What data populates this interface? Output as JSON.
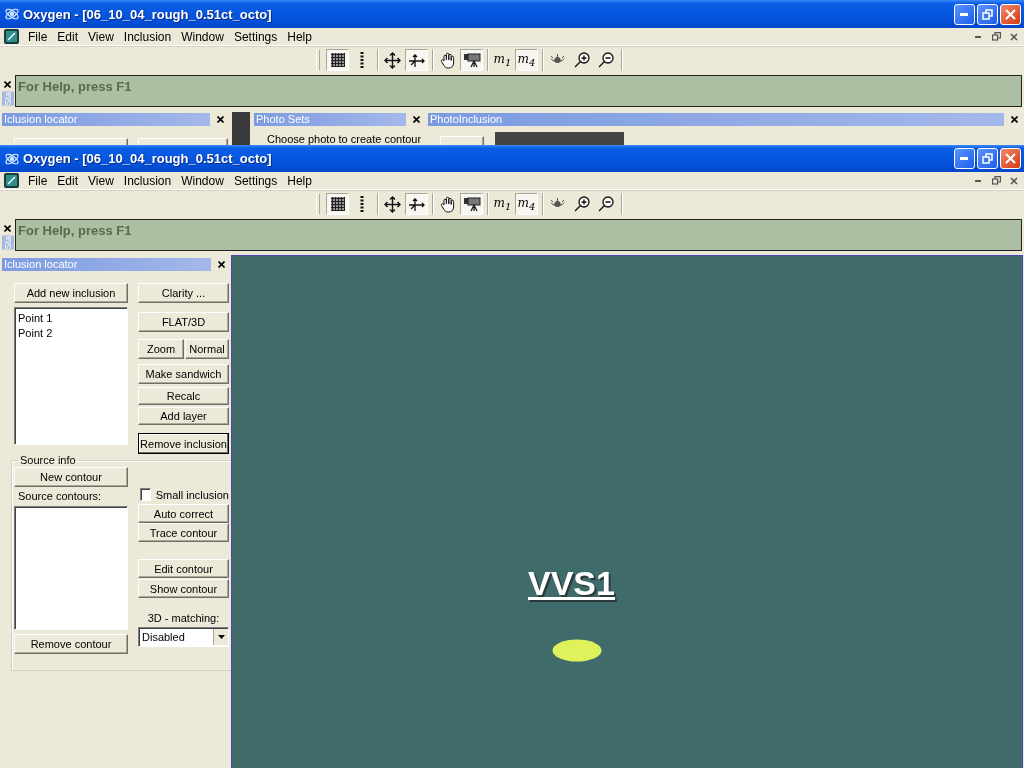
{
  "windows": [
    {
      "kind": "covered",
      "title": "Oxygen - [06_10_04_rough_0.51ct_octo]",
      "menu": [
        "File",
        "Edit",
        "View",
        "Inclusion",
        "Window",
        "Settings",
        "Help"
      ],
      "toolbar": [
        {
          "buttons": [
            {
              "kind": "grid",
              "selected": true
            },
            {
              "kind": "dots",
              "selected": false
            }
          ]
        },
        {
          "buttons": [
            {
              "kind": "move",
              "selected": false
            },
            {
              "kind": "axes",
              "selected": true
            }
          ]
        },
        {
          "buttons": [
            {
              "kind": "hand",
              "selected": false
            },
            {
              "kind": "camera",
              "selected": true
            }
          ]
        },
        {
          "buttons": [
            {
              "kind": "label",
              "label": "m$_{1}$",
              "selected": false
            },
            {
              "kind": "label",
              "label": "m$_{4}$",
              "selected": true
            }
          ]
        },
        {
          "buttons": [
            {
              "kind": "eye",
              "selected": false
            },
            {
              "kind": "zoom_in",
              "selected": false
            },
            {
              "kind": "zoom_out",
              "selected": false
            }
          ]
        }
      ],
      "help_bar": {
        "tab_label": "Sta",
        "text": "For Help, press F1"
      },
      "panels": [
        {
          "kind": "locator",
          "title": "Iclusion locator"
        },
        {
          "kind": "photo_sets",
          "title": "Photo Sets",
          "text": "Choose photo to create contour"
        },
        {
          "kind": "photo_inclusion",
          "title": "PhotoInclusion"
        }
      ]
    },
    {
      "kind": "active",
      "title": "Oxygen - [06_10_04_rough_0.51ct_octo]",
      "menu": [
        "File",
        "Edit",
        "View",
        "Inclusion",
        "Window",
        "Settings",
        "Help"
      ],
      "toolbar": [
        {
          "buttons": [
            {
              "kind": "grid",
              "selected": true
            },
            {
              "kind": "dots",
              "selected": false
            }
          ]
        },
        {
          "buttons": [
            {
              "kind": "move",
              "selected": false
            },
            {
              "kind": "axes",
              "selected": true
            }
          ]
        },
        {
          "buttons": [
            {
              "kind": "hand",
              "selected": false
            },
            {
              "kind": "camera",
              "selected": true
            }
          ]
        },
        {
          "buttons": [
            {
              "kind": "label",
              "label": "m$_{1}$",
              "selected": false
            },
            {
              "kind": "label",
              "label": "m$_{4}$",
              "selected": true
            }
          ]
        },
        {
          "buttons": [
            {
              "kind": "eye",
              "selected": false
            },
            {
              "kind": "zoom_in",
              "selected": false
            },
            {
              "kind": "zoom_out",
              "selected": false
            }
          ]
        }
      ],
      "help_bar": {
        "tab_label": "Sta",
        "text": "For Help, press F1"
      },
      "locator": {
        "title": "Iclusion locator",
        "add_button": "Add new inclusion",
        "points": [
          {
            "label": "Point 1"
          },
          {
            "label": "Point 2"
          }
        ],
        "clarity_button": "Clarity ...",
        "flat_3d_button": "FLAT/3D",
        "zoom_buttons": [
          "Zoom",
          "Normal"
        ],
        "make_sandwich_button": "Make sandwich",
        "recalc_button": "Recalc",
        "add_layer_button": "Add layer",
        "remove_inclusion_button": {
          "label": "Remove inclusion",
          "focused": true
        },
        "source_info": {
          "legend": "Source info",
          "new_contour_button": "New contour",
          "contours_label": "Source contours:",
          "remove_contour_button": "Remove contour",
          "small_inclusion": {
            "label": "Small inclusion",
            "checked": false
          },
          "auto_correct_button": "Auto correct",
          "trace_contour_button": "Trace contour",
          "edit_contour_button": "Edit contour",
          "show_contour_button": "Show contour",
          "matching_label": "3D - matching:",
          "matching_value": "Disabled"
        }
      },
      "canvas": {
        "grade": "VVS1"
      }
    }
  ]
}
